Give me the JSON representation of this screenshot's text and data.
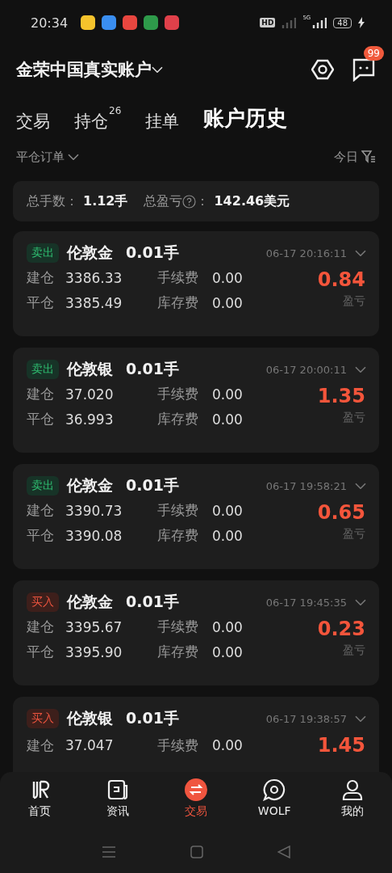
{
  "status_bar": {
    "time": "20:34",
    "hd": "HD",
    "network": "5G",
    "battery": "48"
  },
  "header": {
    "account": "金荣中国真实账户",
    "message_badge": "99"
  },
  "tabs": [
    {
      "label": "交易",
      "selected": false
    },
    {
      "label": "持仓",
      "count": "26",
      "selected": false
    },
    {
      "label": "挂单",
      "selected": false
    },
    {
      "label": "账户历史",
      "selected": true
    }
  ],
  "filter": {
    "order_type": "平仓订单",
    "date": "今日"
  },
  "summary": {
    "lots_label": "总手数：",
    "lots": "1.12手",
    "pnl_label": "总盈亏",
    "colon": "：",
    "pnl": "142.46美元"
  },
  "orders": [
    {
      "kind": "sell",
      "side": "卖出",
      "symbol": "伦敦金",
      "lots": "0.01手",
      "time": "06-17 20:16:11",
      "open_label": "建仓",
      "open": "3386.33",
      "close_label": "平仓",
      "close": "3385.49",
      "fee_label": "手续费",
      "fee": "0.00",
      "swap_label": "库存费",
      "swap": "0.00",
      "profit": "0.84",
      "profit_label": "盈亏"
    },
    {
      "kind": "sell",
      "side": "卖出",
      "symbol": "伦敦银",
      "lots": "0.01手",
      "time": "06-17 20:00:11",
      "open_label": "建仓",
      "open": "37.020",
      "close_label": "平仓",
      "close": "36.993",
      "fee_label": "手续费",
      "fee": "0.00",
      "swap_label": "库存费",
      "swap": "0.00",
      "profit": "1.35",
      "profit_label": "盈亏"
    },
    {
      "kind": "sell",
      "side": "卖出",
      "symbol": "伦敦金",
      "lots": "0.01手",
      "time": "06-17 19:58:21",
      "open_label": "建仓",
      "open": "3390.73",
      "close_label": "平仓",
      "close": "3390.08",
      "fee_label": "手续费",
      "fee": "0.00",
      "swap_label": "库存费",
      "swap": "0.00",
      "profit": "0.65",
      "profit_label": "盈亏"
    },
    {
      "kind": "buy",
      "side": "买入",
      "symbol": "伦敦金",
      "lots": "0.01手",
      "time": "06-17 19:45:35",
      "open_label": "建仓",
      "open": "3395.67",
      "close_label": "平仓",
      "close": "3395.90",
      "fee_label": "手续费",
      "fee": "0.00",
      "swap_label": "库存费",
      "swap": "0.00",
      "profit": "0.23",
      "profit_label": "盈亏"
    },
    {
      "kind": "buy",
      "side": "买入",
      "symbol": "伦敦银",
      "lots": "0.01手",
      "time": "06-17 19:38:57",
      "open_label": "建仓",
      "open": "37.047",
      "fee_label": "手续费",
      "fee": "0.00",
      "profit": "1.45"
    }
  ],
  "bottom_nav": [
    {
      "kind": "home",
      "label": "首页",
      "selected": false
    },
    {
      "kind": "news",
      "label": "资讯",
      "selected": false
    },
    {
      "kind": "trade",
      "label": "交易",
      "selected": true
    },
    {
      "kind": "community",
      "label": "WOLF",
      "selected": false
    },
    {
      "kind": "profile",
      "label": "我的",
      "selected": false
    }
  ]
}
